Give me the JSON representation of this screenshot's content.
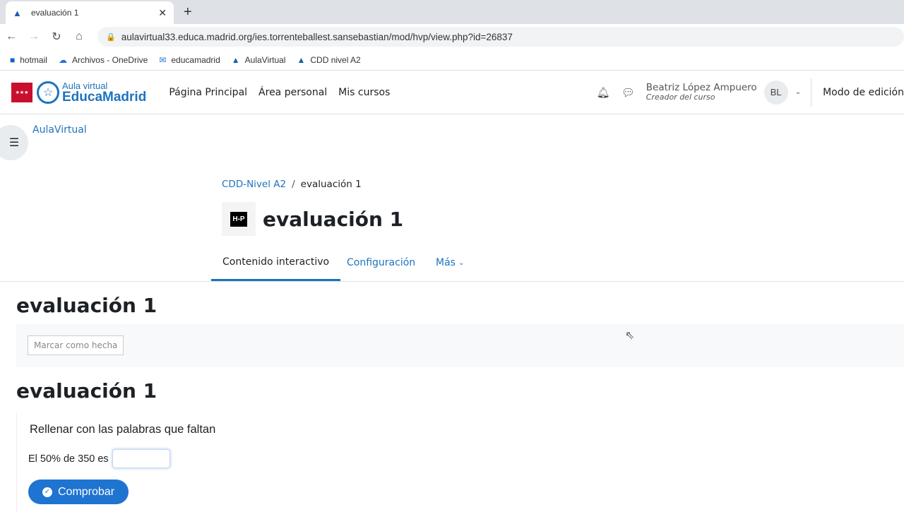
{
  "browser": {
    "tab_title": "evaluación 1",
    "url": "aulavirtual33.educa.madrid.org/ies.torrenteballest.sansebastian/mod/hvp/view.php?id=26837",
    "bookmarks": [
      {
        "label": "hotmail",
        "icon": "outlook-icon"
      },
      {
        "label": "Archivos - OneDrive",
        "icon": "onedrive-icon"
      },
      {
        "label": "educamadrid",
        "icon": "mail-icon"
      },
      {
        "label": "AulaVirtual",
        "icon": "moodle-cap-icon"
      },
      {
        "label": "CDD nivel A2",
        "icon": "moodle-cap-icon"
      }
    ]
  },
  "header": {
    "logo_top": "Aula virtual",
    "logo_bottom": "EducaMadrid",
    "menu": [
      "Página Principal",
      "Área personal",
      "Mis cursos"
    ],
    "user_name": "Beatriz López Ampuero",
    "user_role": "Creador del curso",
    "avatar": "BL",
    "edit_mode": "Modo de edición"
  },
  "site_crumb": "AulaVirtual",
  "breadcrumb": [
    "CDD-Nivel A2",
    "evaluación 1"
  ],
  "page_title": "evaluación 1",
  "hp_badge": "H-P",
  "tabs": [
    "Contenido interactivo",
    "Configuración",
    "Más"
  ],
  "section_title": "evaluación 1",
  "mark_done": "Marcar como hecha",
  "activity_title": "evaluación 1",
  "h5p": {
    "instruction": "Rellenar con las palabras que faltan",
    "question": "El 50% de 350 es",
    "answer": "",
    "check": "Comprobar"
  },
  "colors": {
    "accent": "#1e73be",
    "button": "#1f73d1"
  }
}
